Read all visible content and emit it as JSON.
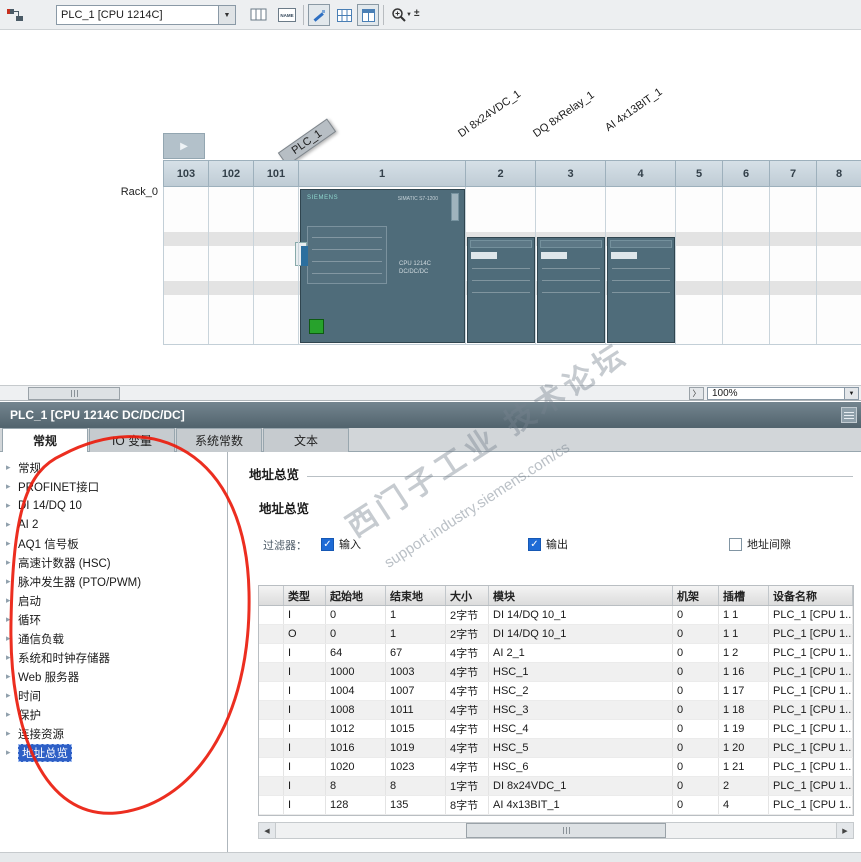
{
  "icons": {
    "dropdown_arrow": "▼",
    "expander_arrow": "▶",
    "chevron_right": "〉",
    "nav_bullet": "▸",
    "check_mark": "✓",
    "scroll_left": "◀",
    "scroll_right": "▶",
    "plus_minus": "±"
  },
  "toolbar": {
    "device_combo": "PLC_1 [CPU 1214C]",
    "name_tag_label": "NAME"
  },
  "device_view": {
    "rack_label": "Rack_0",
    "slot_headers": [
      "103",
      "102",
      "101",
      "1",
      "2",
      "3",
      "4",
      "5",
      "6",
      "7",
      "8"
    ],
    "module_tags": {
      "plc": "PLC_1",
      "slot2": "DI 8x24VDC_1",
      "slot3": "DQ 8xRelay_1",
      "slot4": "AI 4x13BIT_1"
    },
    "cpu": {
      "brand": "SIEMENS",
      "series": "SIMATIC S7-1200",
      "name_line1": "CPU 1214C",
      "name_line2": "DC/DC/DC"
    }
  },
  "splitter": {
    "zoom_value": "100%"
  },
  "properties": {
    "title": "PLC_1 [CPU 1214C DC/DC/DC]",
    "tabs": [
      {
        "label": "常规",
        "active": true
      },
      {
        "label": "IO 变量",
        "active": false
      },
      {
        "label": "系统常数",
        "active": false
      },
      {
        "label": "文本",
        "active": false
      }
    ],
    "nav": {
      "items": [
        "常规",
        "PROFINET接口",
        "DI 14/DQ 10",
        "AI 2",
        "AQ1 信号板",
        "高速计数器 (HSC)",
        "脉冲发生器 (PTO/PWM)",
        "启动",
        "循环",
        "通信负载",
        "系统和时钟存储器",
        "Web 服务器",
        "时间",
        "保护",
        "连接资源",
        "地址总览"
      ],
      "selected_index": 15
    },
    "overview": {
      "page_title": "地址总览",
      "section_title": "地址总览",
      "filter_label": "过滤器：",
      "filters": [
        {
          "label": "输入",
          "checked": true
        },
        {
          "label": "输出",
          "checked": true
        },
        {
          "label": "地址间隙",
          "checked": false
        }
      ],
      "table": {
        "columns": [
          "类型",
          "起始地",
          "结束地",
          "大小",
          "模块",
          "机架",
          "插槽",
          "设备名称"
        ],
        "rows": [
          [
            "I",
            "0",
            "1",
            "2字节",
            "DI 14/DQ 10_1",
            "0",
            "1 1",
            "PLC_1 [CPU 1..."
          ],
          [
            "O",
            "0",
            "1",
            "2字节",
            "DI 14/DQ 10_1",
            "0",
            "1 1",
            "PLC_1 [CPU 1..."
          ],
          [
            "I",
            "64",
            "67",
            "4字节",
            "AI 2_1",
            "0",
            "1 2",
            "PLC_1 [CPU 1..."
          ],
          [
            "I",
            "1000",
            "1003",
            "4字节",
            "HSC_1",
            "0",
            "1 16",
            "PLC_1 [CPU 1..."
          ],
          [
            "I",
            "1004",
            "1007",
            "4字节",
            "HSC_2",
            "0",
            "1 17",
            "PLC_1 [CPU 1..."
          ],
          [
            "I",
            "1008",
            "1011",
            "4字节",
            "HSC_3",
            "0",
            "1 18",
            "PLC_1 [CPU 1..."
          ],
          [
            "I",
            "1012",
            "1015",
            "4字节",
            "HSC_4",
            "0",
            "1 19",
            "PLC_1 [CPU 1..."
          ],
          [
            "I",
            "1016",
            "1019",
            "4字节",
            "HSC_5",
            "0",
            "1 20",
            "PLC_1 [CPU 1..."
          ],
          [
            "I",
            "1020",
            "1023",
            "4字节",
            "HSC_6",
            "0",
            "1 21",
            "PLC_1 [CPU 1..."
          ],
          [
            "I",
            "8",
            "8",
            "1字节",
            "DI 8x24VDC_1",
            "0",
            "2",
            "PLC_1 [CPU 1..."
          ],
          [
            "I",
            "128",
            "135",
            "8字节",
            "AI 4x13BIT_1",
            "0",
            "4",
            "PLC_1 [CPU 1..."
          ]
        ]
      }
    }
  },
  "watermark": {
    "line1": "西门子工业 技术论坛",
    "line2": "support.industry.siemens.com/cs"
  }
}
